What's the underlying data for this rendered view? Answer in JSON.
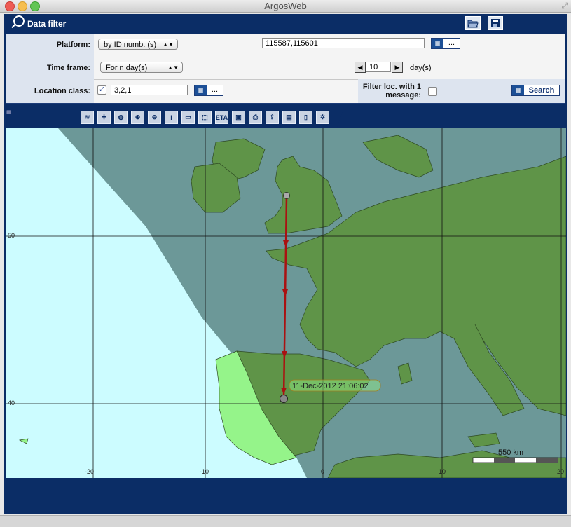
{
  "window": {
    "title": "ArgosWeb"
  },
  "panel": {
    "title": "Data filter",
    "open_icon": "folder-open-icon",
    "save_icon": "floppy-disk-icon"
  },
  "filter": {
    "platform": {
      "label": "Platform:",
      "mode": "by ID numb. (s)",
      "ids": "115587,115601",
      "picker_label": "..."
    },
    "time_frame": {
      "label": "Time frame:",
      "mode": "For n day(s)",
      "n": "10",
      "unit": "day(s)"
    },
    "location_class": {
      "label": "Location class:",
      "checked": true,
      "value": "3,2,1",
      "picker_label": "..."
    },
    "filter_single": {
      "label_line1": "Filter loc. with 1",
      "label_line2": "message:",
      "checked": false
    },
    "search_label": "Search"
  },
  "toolbar": {
    "tools": [
      "layers-icon",
      "crosshair-icon",
      "world-map-icon",
      "zoom-in-icon",
      "zoom-out-icon",
      "info-icon",
      "ruler-icon",
      "select-area-icon",
      "eta-icon",
      "save-map-icon",
      "print-icon",
      "export-icon",
      "export-image-icon",
      "document-icon",
      "settings-icon"
    ],
    "eta_label": "ETA"
  },
  "map": {
    "lat_labels": [
      "50",
      "40"
    ],
    "lon_labels": [
      "-20",
      "-10",
      "0",
      "10",
      "20"
    ],
    "track_label": "11-Dec-2012 21:06:02",
    "scale_label": "550 km",
    "colors": {
      "ocean_day": "#ccfcff",
      "ocean_night": "#6c9898",
      "land_day": "#95f48a",
      "land_night": "#5f9448",
      "track": "#aa1111"
    }
  }
}
